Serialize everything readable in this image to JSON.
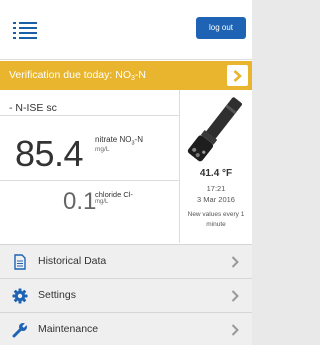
{
  "header": {
    "logout_label": "log out"
  },
  "alert": {
    "text_main": "Verification due today: NO",
    "text_sub": "3",
    "text_tail": "-N"
  },
  "sensor": {
    "name": "- N-ISE sc",
    "primary": {
      "value": "85.4",
      "param_main": "nitrate NO",
      "param_sub": "3",
      "param_tail": "-N",
      "unit": "mg/L"
    },
    "secondary": {
      "value": "0.1",
      "param": "chloride Cl-",
      "unit": "mg/L"
    },
    "temperature": "41.4 °F",
    "time": "17:21",
    "date": "3 Mar 2016",
    "refresh_note": "New values every 1 minute"
  },
  "menu": {
    "items": [
      {
        "label": "Historical Data",
        "icon": "document-icon"
      },
      {
        "label": "Settings",
        "icon": "gear-icon"
      },
      {
        "label": "Maintenance",
        "icon": "wrench-icon"
      }
    ]
  },
  "colors": {
    "accent_blue": "#1f64b4",
    "alert_yellow": "#e9b52e"
  }
}
